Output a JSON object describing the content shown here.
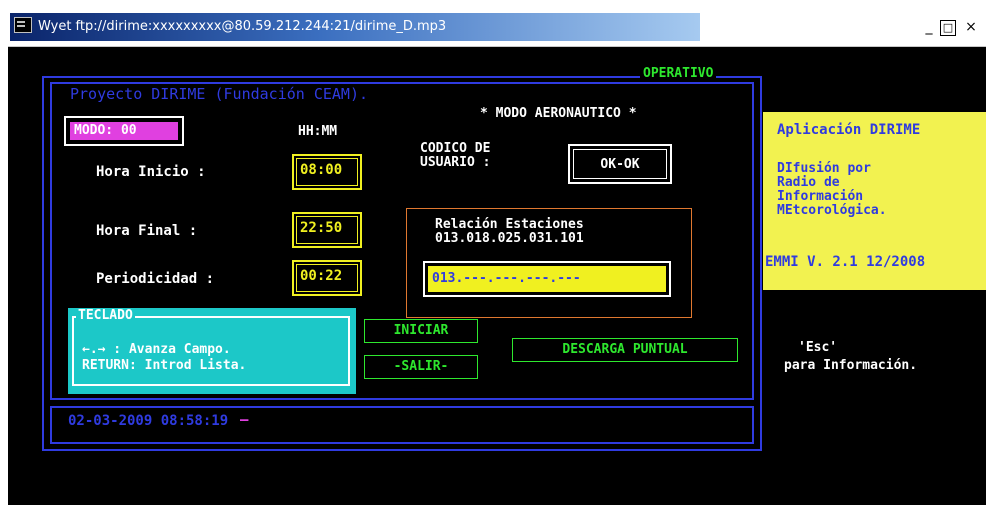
{
  "window": {
    "title": "Wyet ftp://dirime:xxxxxxxxx@80.59.212.244:21/dirime_D.mp3",
    "controls": {
      "minimize": "_",
      "maximize": "□",
      "close": "×"
    }
  },
  "status": {
    "operative": "OPERATIVO"
  },
  "project": {
    "title": "Proyecto DIRIME (Fundación CEAM)."
  },
  "mode": {
    "banner": "* MODO AERONAUTICO *",
    "label": "MODO: 00"
  },
  "time": {
    "header": "HH:MM",
    "start_label": "Hora  Inicio :",
    "start_value": "08:00",
    "end_label": "Hora  Final  :",
    "end_value": "22:50",
    "period_label": "Periodicidad :",
    "period_value": "00:22"
  },
  "user": {
    "label_line1": "CODICO DE",
    "label_line2": "USUARIO :",
    "value": "OK-OK"
  },
  "stations": {
    "title": "Relación Estaciones",
    "list": "013.018.025.031.101",
    "input_value": "013.---.---.---.---"
  },
  "keyboard": {
    "title": "TECLADO",
    "line1": "←.→  : Avanza Campo.",
    "line2": "RETURN: Introd Lista."
  },
  "buttons": {
    "start": "INICIAR",
    "exit": "-SALIR-",
    "download": "DESCARGA  PUNTUAL"
  },
  "footer": {
    "datetime": "02-03-2009  08:58:19",
    "dash": "—"
  },
  "side": {
    "app_title": "Aplicación DIRIME",
    "desc1": "DIfusión por",
    "desc2": "Radio de",
    "desc3": "Información",
    "desc4": "MEtcorológica.",
    "version": "EMMI V. 2.1 12/2008"
  },
  "help": {
    "key": "'Esc'",
    "text": "para Información."
  },
  "colors": {
    "blue": "#2f3be0",
    "green": "#2ee82e",
    "yellow": "#f0f020",
    "magenta": "#e040e0",
    "cyan": "#1cc8c8"
  }
}
